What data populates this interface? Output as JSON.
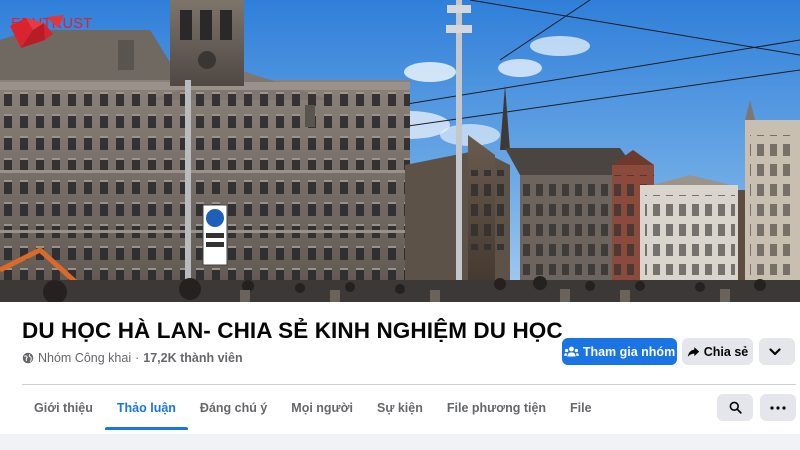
{
  "brand": {
    "name": "EDUTRUST",
    "color": "#d9232e"
  },
  "group": {
    "title": "DU HỌC HÀ LAN- CHIA SẺ KINH NGHIỆM DU HỌC",
    "privacy": "Nhóm Công khai",
    "separator": "·",
    "members": "17,2K thành viên"
  },
  "actions": {
    "join_label": "Tham gia nhóm",
    "share_label": "Chia sẻ",
    "more_icon": "chevron-down-icon"
  },
  "tabs": [
    {
      "label": "Giới thiệu",
      "active": false
    },
    {
      "label": "Thảo luận",
      "active": true
    },
    {
      "label": "Đáng chú ý",
      "active": false
    },
    {
      "label": "Mọi người",
      "active": false
    },
    {
      "label": "Sự kiện",
      "active": false
    },
    {
      "label": "File phương tiện",
      "active": false
    },
    {
      "label": "File",
      "active": false
    }
  ],
  "toolbar": {
    "search_icon": "search-icon",
    "more_icon": "more-icon"
  },
  "colors": {
    "accent": "#1b74e4",
    "secondary_button": "#e4e6eb",
    "muted_text": "#65676b",
    "sky": "#4a8ed8"
  }
}
